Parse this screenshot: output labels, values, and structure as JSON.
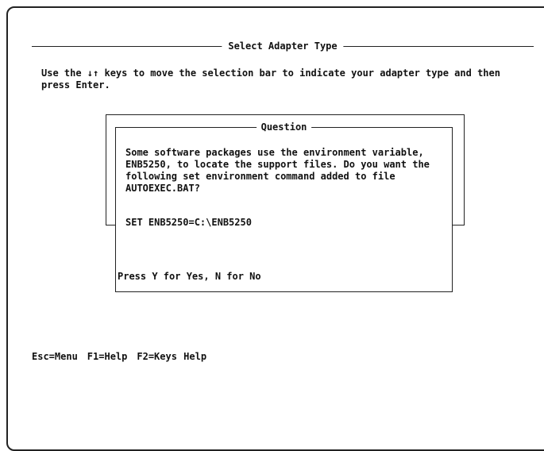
{
  "main": {
    "title": "Select Adapter Type",
    "instructions": "Use the ↓↑ keys to move the selection bar to indicate your adapter type and then press Enter."
  },
  "dialog": {
    "title": "Question",
    "message": "Some software packages use the environment variable, ENB5250, to locate the support files. Do you want the following set environment command added to file AUTOEXEC.BAT?",
    "command": "SET ENB5250=C:\\ENB5250",
    "prompt": "Press Y for Yes,  N for No"
  },
  "function_keys": [
    "Esc=Menu",
    "F1=Help",
    "F2=Keys Help"
  ]
}
